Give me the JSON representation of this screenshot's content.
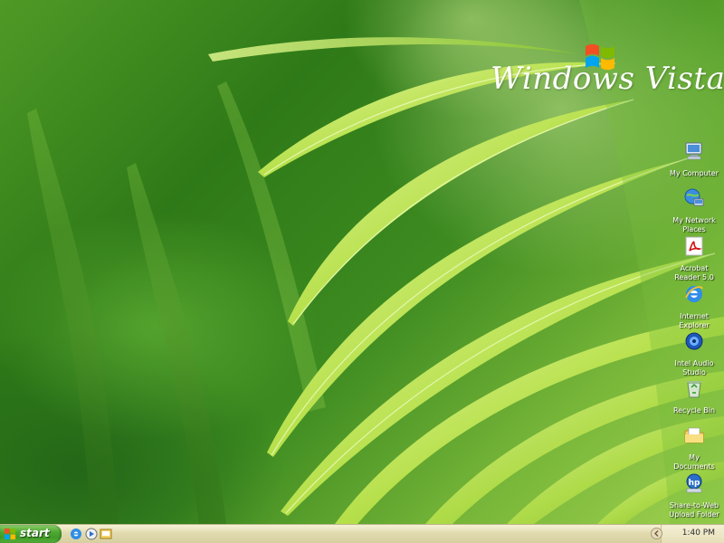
{
  "wallpaper": {
    "logo_text": "Windows Vista"
  },
  "desktop_icons": [
    {
      "label": "My Computer",
      "icon": "computer-icon"
    },
    {
      "label": "My Network Places",
      "icon": "network-places-icon"
    },
    {
      "label": "Acrobat Reader 5.0",
      "icon": "acrobat-reader-icon"
    },
    {
      "label": "Internet Explorer",
      "icon": "internet-explorer-icon"
    },
    {
      "label": "Intel Audio Studio",
      "icon": "audio-studio-icon"
    },
    {
      "label": "Recycle Bin",
      "icon": "recycle-bin-icon"
    },
    {
      "label": "My Documents",
      "icon": "documents-folder-icon"
    },
    {
      "label": "Share-to-Web Upload Folder",
      "icon": "upload-folder-icon"
    }
  ],
  "taskbar": {
    "start_label": "start",
    "quick_launch": [
      {
        "icon": "internet-explorer-icon"
      },
      {
        "icon": "media-player-icon"
      },
      {
        "icon": "show-desktop-icon"
      }
    ],
    "clock": "1:40 PM"
  },
  "colors": {
    "taskbar": "#e2dbb0",
    "start_button": "#4ea832",
    "wallpaper_green": "#3c8a20"
  }
}
